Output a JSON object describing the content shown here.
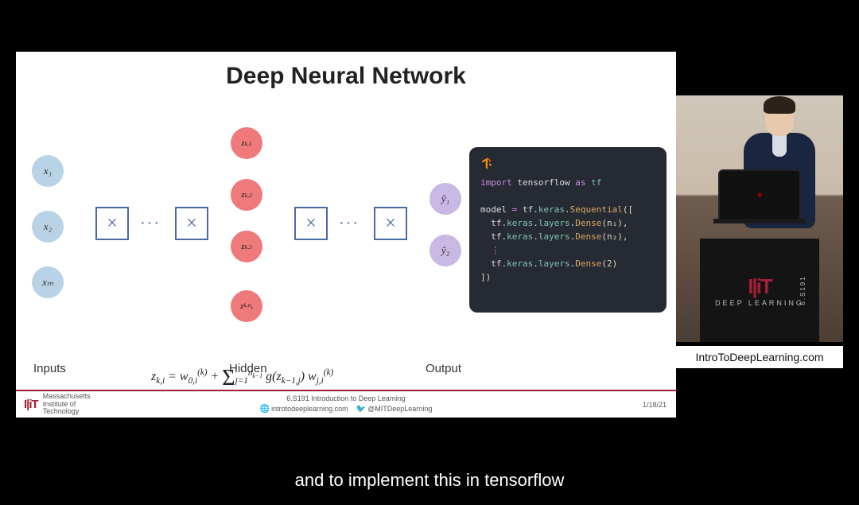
{
  "slide": {
    "title": "Deep Neural Network",
    "inputs_label": "Inputs",
    "hidden_label": "Hidden",
    "output_label": "Output",
    "inputs": [
      "x₁",
      "x₂",
      "xₘ"
    ],
    "hidden_nodes": [
      "z_{k,1}",
      "z_{k,2}",
      "z_{k,3}",
      "z_{k,n_k}"
    ],
    "outputs": [
      "ŷ₁",
      "ŷ₂"
    ],
    "ellipsis": "···",
    "box_symbol": "×",
    "formula_html": "z<sub>k,i</sub> = w<sub>0,i</sub><sup>(k)</sup> + <span class=\"sigma\">Σ</span><sub>j=1</sub><sup>n<sub>k−1</sub></sup> g(z<sub>k−1,j</sub>) w<sub>j,i</sub><sup>(k)</sup>",
    "code": {
      "line1_import": "import",
      "line1_rest": " tensorflow ",
      "line1_as": "as",
      "line1_tf": " tf",
      "line2_a": "model ",
      "line2_eq": "=",
      "line2_b": " tf.",
      "line2_c": "keras",
      "line2_d": ".Sequential([",
      "line3": "  tf.keras.layers.Dense(n₁),",
      "line4": "  tf.keras.layers.Dense(n₂),",
      "line5": "  ⋮",
      "line6": "  tf.keras.layers.Dense(2)",
      "line7": "])"
    }
  },
  "footer": {
    "mit_logo": "I|iT",
    "mit_text_line1": "Massachusetts",
    "mit_text_line2": "Institute of",
    "mit_text_line3": "Technology",
    "course": "6.S191 Introduction to Deep Learning",
    "web": "introtodeeplearning.com",
    "handle": "@MITDeepLearning",
    "date": "1/18/21"
  },
  "speaker": {
    "podium_logo": "I|iT",
    "podium_sub": "DEEP LEARNING",
    "podium_side": "6.S191",
    "url": "IntroToDeepLearning.com"
  },
  "subtitle": "and to implement this in tensorflow"
}
